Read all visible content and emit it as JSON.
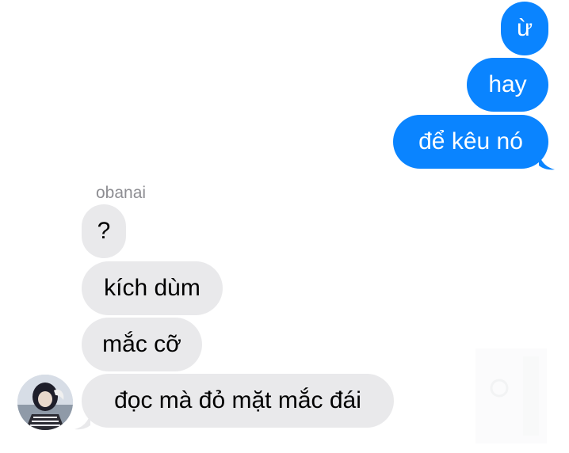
{
  "conversation": {
    "outgoing": [
      {
        "text": "ừ"
      },
      {
        "text": "hay"
      },
      {
        "text": "để kêu nó"
      }
    ],
    "incoming_sender": "obanai",
    "incoming": [
      {
        "text": "?"
      },
      {
        "text": "kích dùm"
      },
      {
        "text": "mắc cỡ"
      },
      {
        "text": "đọc mà đỏ mặt mắc đái"
      }
    ]
  },
  "colors": {
    "outgoing_bubble": "#0a84ff",
    "incoming_bubble": "#e9e9eb",
    "sender_label": "#8e8e93"
  },
  "icons": {
    "avatar": "contact-avatar-icon",
    "faded_overlay": "faded-overlay-icon"
  }
}
